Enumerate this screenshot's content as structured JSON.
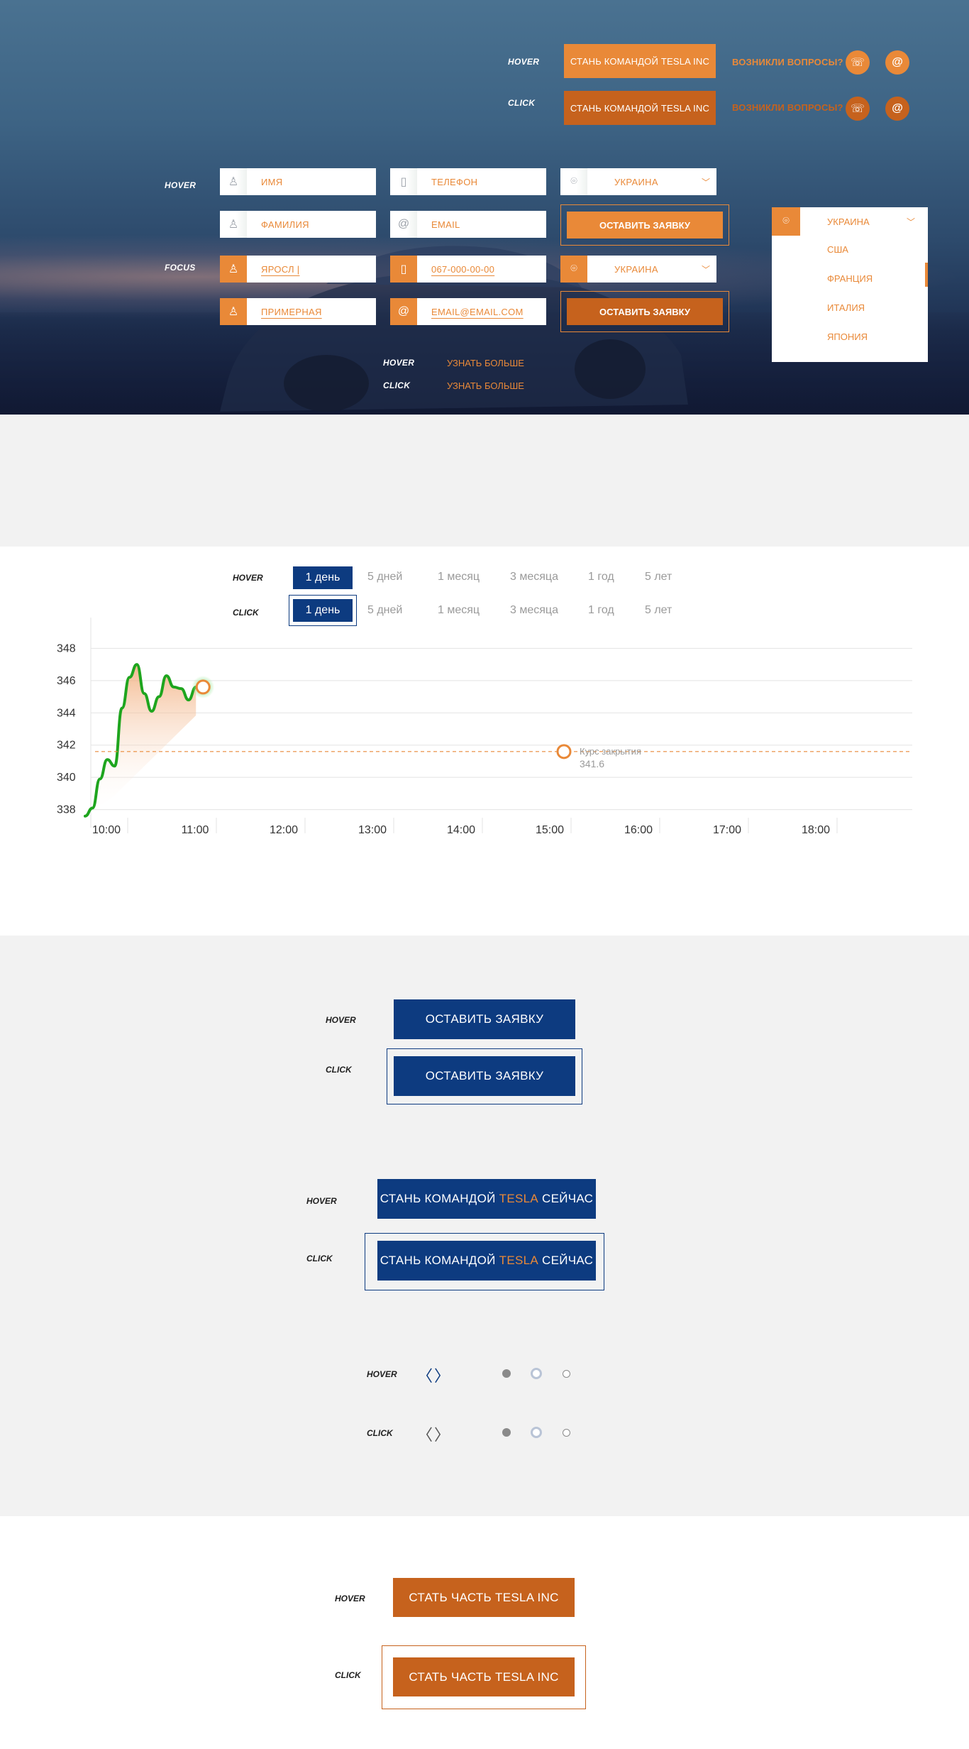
{
  "hero": {
    "top_hover_label": "HOVER",
    "top_click_label": "CLICK",
    "cta_label": "СТАНЬ КОМАНДОЙ TESLA INC",
    "questions_label": "ВОЗНИКЛИ ВОПРОСЫ?",
    "phone_icon": "☏",
    "email_icon": "@",
    "form_hover_label": "HOVER",
    "form_focus_label": "FOCUS",
    "fields": {
      "name_placeholder": "ИМЯ",
      "phone_placeholder": "ТЕЛЕФОН",
      "country_value": "УКРАИНА",
      "surname_placeholder": "ФАМИЛИЯ",
      "email_placeholder": "EMAIL",
      "submit_label": "ОСТАВИТЬ ЗАЯВКУ",
      "name_value": "ЯРОСЛ |",
      "phone_value": "067-000-00-00",
      "surname_value": "ПРИМЕРНАЯ",
      "email_value": "EMAIL@EMAIL.COM"
    },
    "dropdown": {
      "selected": "УКРАИНА",
      "options": [
        "США",
        "ФРАНЦИЯ",
        "ИТАЛИЯ",
        "ЯПОНИЯ"
      ]
    },
    "learn_more_hover_label": "HOVER",
    "learn_more_click_label": "CLICK",
    "learn_more": "УЗНАТЬ БОЛЬШЕ"
  },
  "periods": {
    "hover_label": "HOVER",
    "click_label": "CLICK",
    "items": [
      "1 день",
      "5 дней",
      "1 месяц",
      "3 месяца",
      "1 год",
      "5 лет"
    ]
  },
  "chart_data": {
    "type": "line",
    "title": "",
    "x": [
      "10:00",
      "10:05",
      "10:10",
      "10:15",
      "10:20",
      "10:25",
      "10:30",
      "10:35",
      "10:40",
      "10:45",
      "10:50",
      "10:55",
      "11:00",
      "11:05",
      "11:10",
      "11:15"
    ],
    "series": [
      {
        "values": [
          337.6,
          338.1,
          339.9,
          341.1,
          340.7,
          344.3,
          346.2,
          347.0,
          345.2,
          344.1,
          345.0,
          346.3,
          345.6,
          345.5,
          344.8,
          345.6
        ]
      }
    ],
    "xlabel": "",
    "ylabel": "",
    "x_ticks": [
      "10:00",
      "11:00",
      "12:00",
      "13:00",
      "14:00",
      "15:00",
      "16:00",
      "17:00",
      "18:00"
    ],
    "y_ticks": [
      "348",
      "346",
      "344",
      "342",
      "340",
      "338"
    ],
    "ylim": [
      337.5,
      348.5
    ],
    "grid": true,
    "reference_line": {
      "value": 341.6,
      "label": "Курс закрытия",
      "value_label": "341.6"
    },
    "line_color": "#1ea51e",
    "marker_color": "#e98938"
  },
  "blue_buttons": {
    "hover_label": "HOVER",
    "click_label": "CLICK",
    "submit_label": "ОСТАВИТЬ ЗАЯВКУ",
    "team_prefix": "СТАНЬ КОМАНДОЙ ",
    "team_accent": "TESLA",
    "team_suffix": " СЕЙЧАС"
  },
  "slider_nav": {
    "hover_label": "HOVER",
    "click_label": "CLICK",
    "prev_icon": "〈",
    "next_icon": "〉"
  },
  "rust_buttons": {
    "hover_label": "HOVER",
    "click_label": "CLICK",
    "label": "СТАТЬ ЧАСТЬ TESLA INC"
  },
  "colors": {
    "orange": "#e98938",
    "orange_dark": "#c6621d",
    "navy": "#0d3b80",
    "grey_bg": "#f2f2f2"
  }
}
